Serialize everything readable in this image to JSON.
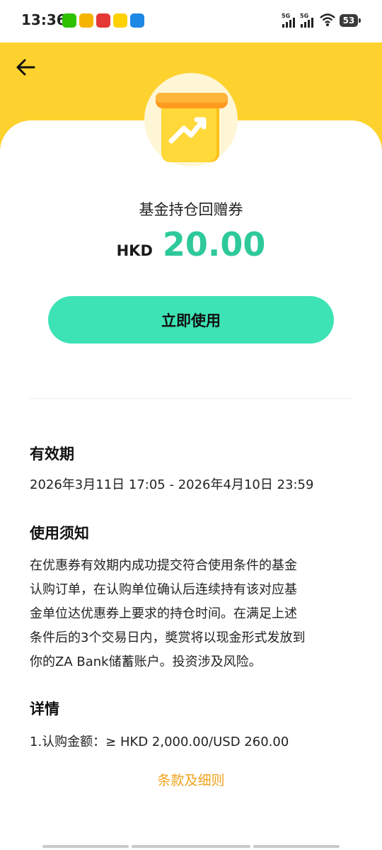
{
  "status_bar": {
    "time": "13:36",
    "battery": "53",
    "signal_labels": [
      "5G",
      "5G"
    ],
    "notification_icons": [
      "wechat-icon",
      "mail-app-icon",
      "taobao-icon",
      "meituan-icon",
      "app-icon"
    ]
  },
  "header": {
    "back_icon": "arrow-left-icon"
  },
  "coupon": {
    "title": "基金持仓回赠券",
    "currency": "HKD",
    "amount": "20.00",
    "use_button": "立即使用"
  },
  "validity": {
    "heading": "有效期",
    "value": "2026年3月11日 17:05 - 2026年4月10日 23:59"
  },
  "usage_notice": {
    "heading": "使用须知",
    "lines": [
      "在优惠券有效期内成功提交符合使用条件的基金",
      "认购订单，在认购单位确认后连续持有该对应基",
      "金单位达优惠券上要求的持仓时间。在满足上述",
      "条件后的3个交易日内，奬赏将以现金形式发放到",
      "你的ZA Bank储蓄账户。投资涉及风险。"
    ]
  },
  "details": {
    "heading": "详情",
    "item": "1.认购金额：≥ HKD 2,000.00/USD 260.00"
  },
  "terms_link": "条款及细则",
  "colors": {
    "header_yellow": "#FDD22E",
    "amount_green": "#2EC99A",
    "button_green": "#3DE3B5",
    "link_orange": "#F0A21C"
  }
}
